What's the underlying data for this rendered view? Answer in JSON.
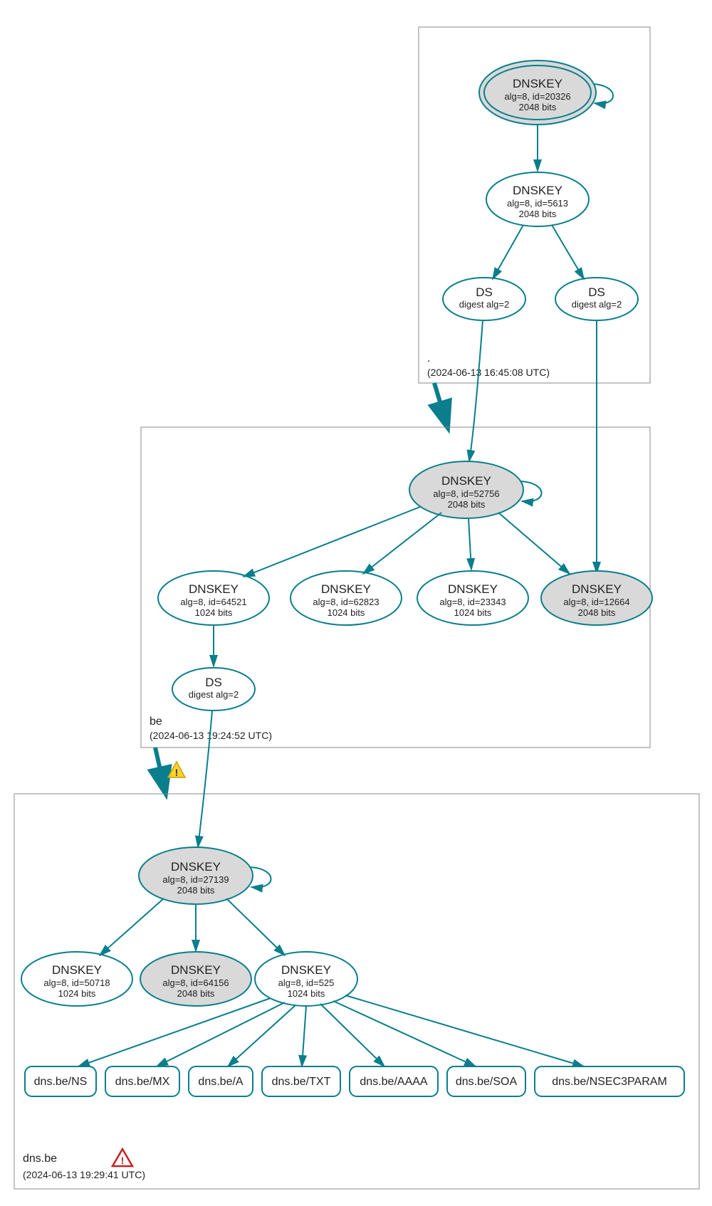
{
  "colors": {
    "stroke": "#0a7e8c",
    "grey": "#d9d9d9"
  },
  "zones": {
    "root": {
      "name": ".",
      "timestamp": "(2024-06-13 16:45:08 UTC)"
    },
    "be": {
      "name": "be",
      "timestamp": "(2024-06-13 19:24:52 UTC)"
    },
    "dnsbe": {
      "name": "dns.be",
      "timestamp": "(2024-06-13 19:29:41 UTC)"
    }
  },
  "nodes": {
    "root_ksk": {
      "title": "DNSKEY",
      "l1": "alg=8, id=20326",
      "l2": "2048 bits"
    },
    "root_zsk": {
      "title": "DNSKEY",
      "l1": "alg=8, id=5613",
      "l2": "2048 bits"
    },
    "root_ds1": {
      "title": "DS",
      "l1": "digest alg=2"
    },
    "root_ds2": {
      "title": "DS",
      "l1": "digest alg=2"
    },
    "be_ksk": {
      "title": "DNSKEY",
      "l1": "alg=8, id=52756",
      "l2": "2048 bits"
    },
    "be_k1": {
      "title": "DNSKEY",
      "l1": "alg=8, id=64521",
      "l2": "1024 bits"
    },
    "be_k2": {
      "title": "DNSKEY",
      "l1": "alg=8, id=62823",
      "l2": "1024 bits"
    },
    "be_k3": {
      "title": "DNSKEY",
      "l1": "alg=8, id=23343",
      "l2": "1024 bits"
    },
    "be_k4": {
      "title": "DNSKEY",
      "l1": "alg=8, id=12664",
      "l2": "2048 bits"
    },
    "be_ds": {
      "title": "DS",
      "l1": "digest alg=2"
    },
    "dns_ksk": {
      "title": "DNSKEY",
      "l1": "alg=8, id=27139",
      "l2": "2048 bits"
    },
    "dns_k1": {
      "title": "DNSKEY",
      "l1": "alg=8, id=50718",
      "l2": "1024 bits"
    },
    "dns_k2": {
      "title": "DNSKEY",
      "l1": "alg=8, id=64156",
      "l2": "2048 bits"
    },
    "dns_k3": {
      "title": "DNSKEY",
      "l1": "alg=8, id=525",
      "l2": "1024 bits"
    }
  },
  "records": {
    "ns": "dns.be/NS",
    "mx": "dns.be/MX",
    "a": "dns.be/A",
    "txt": "dns.be/TXT",
    "aaaa": "dns.be/AAAA",
    "soa": "dns.be/SOA",
    "nsec": "dns.be/NSEC3PARAM"
  }
}
